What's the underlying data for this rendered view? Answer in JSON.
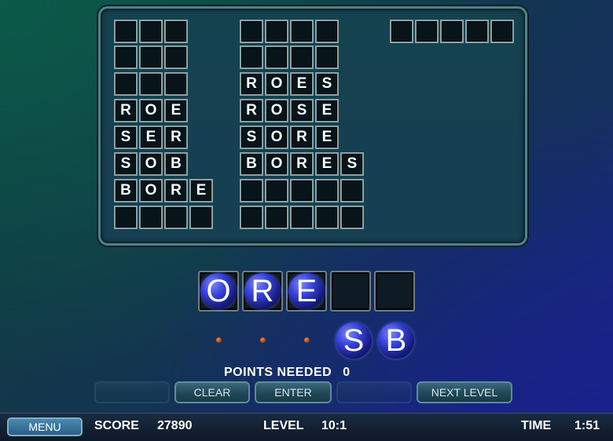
{
  "board": {
    "words": [
      [
        "",
        "",
        ""
      ],
      [
        "",
        "",
        ""
      ],
      [
        "",
        "",
        ""
      ],
      [
        "R",
        "O",
        "E"
      ],
      [
        "S",
        "E",
        "R"
      ],
      [
        "S",
        "O",
        "B"
      ],
      [
        "B",
        "O",
        "R",
        "E"
      ],
      [
        "",
        "",
        "",
        ""
      ],
      [
        "",
        "",
        "",
        ""
      ],
      [
        "",
        "",
        "",
        ""
      ],
      [
        "R",
        "O",
        "E",
        "S"
      ],
      [
        "R",
        "O",
        "S",
        "E"
      ],
      [
        "S",
        "O",
        "R",
        "E"
      ],
      [
        "B",
        "O",
        "R",
        "E",
        "S"
      ],
      [
        "",
        "",
        "",
        "",
        ""
      ],
      [
        "",
        "",
        "",
        "",
        ""
      ],
      [
        "",
        "",
        "",
        "",
        ""
      ]
    ]
  },
  "answer_slots": [
    "O",
    "R",
    "E",
    "",
    ""
  ],
  "rack": {
    "letters": [
      "S",
      "B"
    ]
  },
  "points_needed": {
    "label": "POINTS NEEDED",
    "value": "0"
  },
  "buttons": {
    "faded_1": "",
    "clear": "CLEAR",
    "enter": "ENTER",
    "faded_2": "",
    "next_level": "NEXT LEVEL"
  },
  "status_bar": {
    "menu": "MENU",
    "score_label": "SCORE",
    "score_value": "27890",
    "level_label": "LEVEL",
    "level_value": "10:1",
    "time_label": "TIME",
    "time_value": "1:51"
  },
  "colors": {
    "tile_blue": "#3540d8",
    "board_border": "#557f86"
  }
}
